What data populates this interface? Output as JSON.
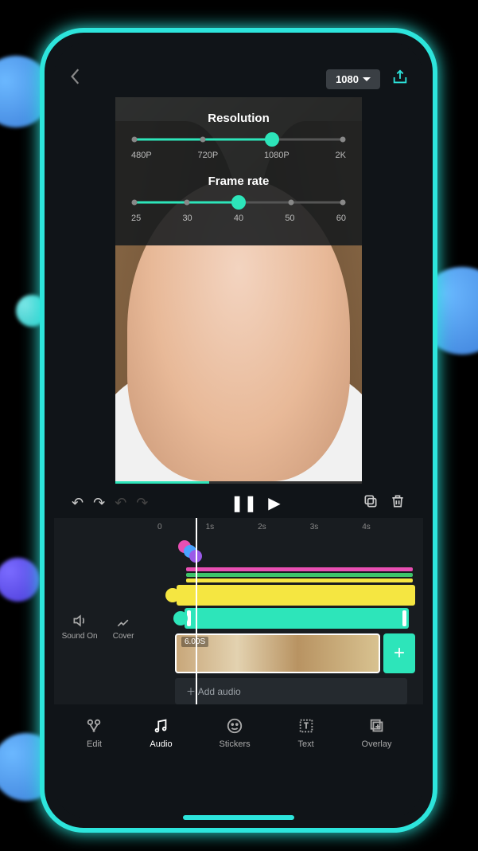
{
  "header": {
    "resolution_pill": "1080"
  },
  "panel": {
    "resolution": {
      "label": "Resolution",
      "stops": [
        "480P",
        "720P",
        "1080P",
        "2K"
      ],
      "value_index": 2
    },
    "framerate": {
      "label": "Frame rate",
      "stops": [
        "25",
        "30",
        "40",
        "50",
        "60"
      ],
      "value_index": 2
    }
  },
  "timeline": {
    "ruler": [
      "0",
      "1s",
      "2s",
      "3s",
      "4s"
    ],
    "clip_duration_badge": "6.00S",
    "add_audio_label": "Add audio"
  },
  "side_controls": {
    "sound": "Sound On",
    "cover": "Cover"
  },
  "tabs": {
    "edit": "Edit",
    "audio": "Audio",
    "stickers": "Stickers",
    "text": "Text",
    "overlay": "Overlay"
  },
  "colors": {
    "accent": "#2de5ba",
    "yellow": "#f5e641",
    "magenta": "#e84fb3",
    "green": "#3ec46a",
    "blue": "#4aa3ff",
    "purple": "#9a5ae8"
  }
}
